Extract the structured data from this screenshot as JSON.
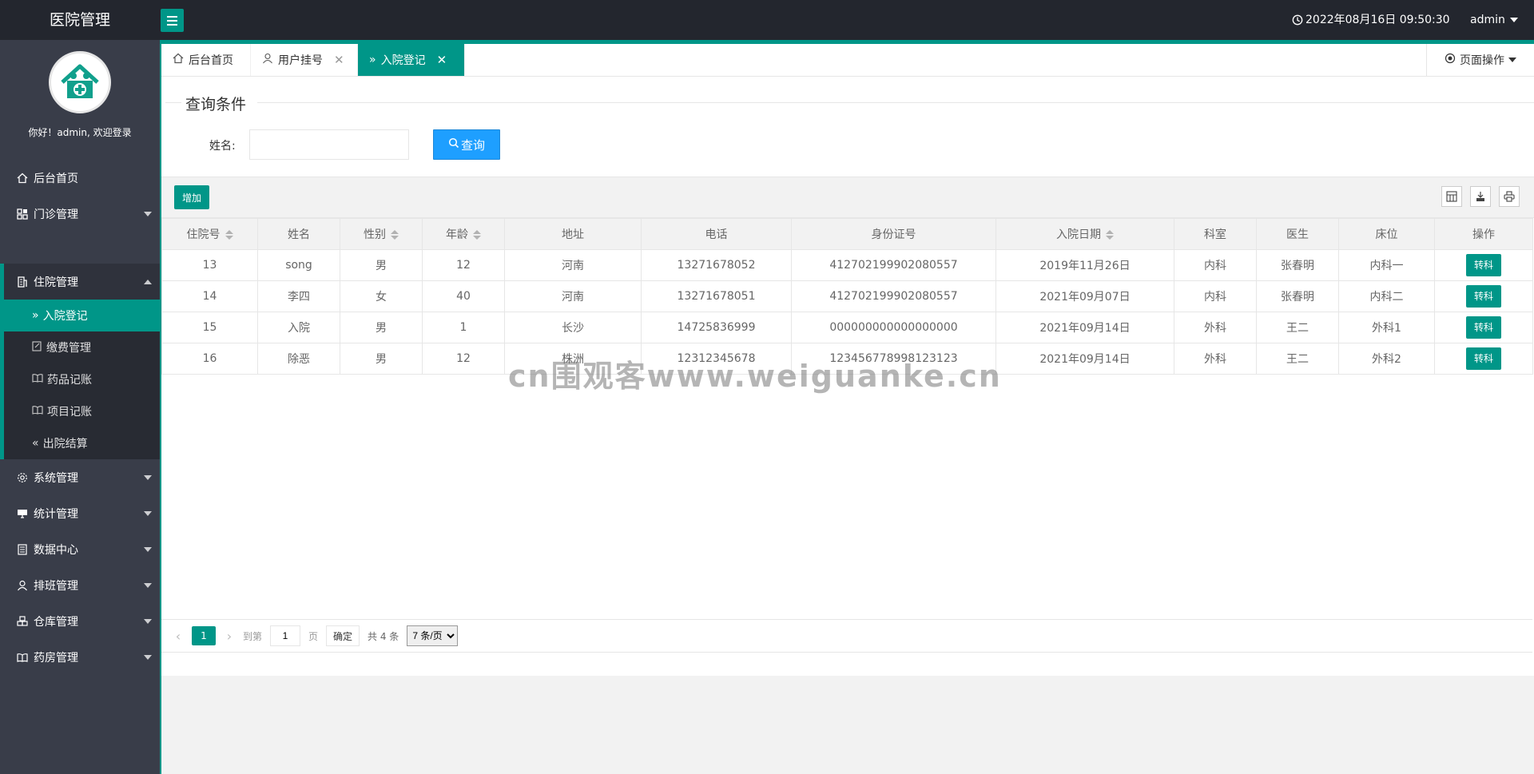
{
  "header": {
    "brand": "医院管理",
    "datetime": "2022年08月16日 09:50:30",
    "user": "admin"
  },
  "sidebar": {
    "greeting": "你好！admin, 欢迎登录",
    "items": [
      {
        "label": "后台首页",
        "icon": "home-icon"
      },
      {
        "label": "门诊管理",
        "icon": "apps-icon"
      },
      {
        "label": "住院管理",
        "icon": "building-icon",
        "expanded": true
      },
      {
        "label": "系统管理",
        "icon": "gear-icon"
      },
      {
        "label": "统计管理",
        "icon": "monitor-icon"
      },
      {
        "label": "数据中心",
        "icon": "document-icon"
      },
      {
        "label": "排班管理",
        "icon": "user-icon"
      },
      {
        "label": "仓库管理",
        "icon": "boxes-icon"
      },
      {
        "label": "药房管理",
        "icon": "book-icon"
      }
    ],
    "subitems": [
      {
        "label": "入院登记",
        "icon": "double-chevron-right-icon",
        "active": true
      },
      {
        "label": "缴费管理",
        "icon": "edit-icon"
      },
      {
        "label": "药品记账",
        "icon": "book-icon"
      },
      {
        "label": "项目记账",
        "icon": "book-icon"
      },
      {
        "label": "出院结算",
        "icon": "double-chevron-left-icon"
      }
    ]
  },
  "tabs": [
    {
      "label": "后台首页",
      "icon": "home-icon"
    },
    {
      "label": "用户挂号",
      "icon": "user-icon",
      "close": "✕"
    },
    {
      "label": "入院登记",
      "icon": "double-chevron-right-icon",
      "close": "✕",
      "active": true
    }
  ],
  "page_ops": "页面操作",
  "search": {
    "title": "查询条件",
    "name_label": "姓名:",
    "name_value": "",
    "query_label": "查询"
  },
  "toolbar": {
    "add_label": "增加"
  },
  "table": {
    "columns": [
      "住院号",
      "姓名",
      "性别",
      "年龄",
      "地址",
      "电话",
      "身份证号",
      "入院日期",
      "科室",
      "医生",
      "床位",
      "操作"
    ],
    "rows": [
      [
        "13",
        "song",
        "男",
        "12",
        "河南",
        "13271678052",
        "412702199902080557",
        "2019年11月26日",
        "内科",
        "张春明",
        "内科一",
        "转科"
      ],
      [
        "14",
        "李四",
        "女",
        "40",
        "河南",
        "13271678051",
        "412702199902080557",
        "2021年09月07日",
        "内科",
        "张春明",
        "内科二",
        "转科"
      ],
      [
        "15",
        "入院",
        "男",
        "1",
        "长沙",
        "14725836999",
        "000000000000000000",
        "2021年09月14日",
        "外科",
        "王二",
        "外科1",
        "转科"
      ],
      [
        "16",
        "除恶",
        "男",
        "12",
        "株洲",
        "12312345678",
        "123456778998123123",
        "2021年09月14日",
        "外科",
        "王二",
        "外科2",
        "转科"
      ]
    ]
  },
  "pager": {
    "current": "1",
    "goto_prefix": "到第",
    "goto_value": "1",
    "goto_suffix": "页",
    "confirm": "确定",
    "total": "共 4 条",
    "page_size": "7 条/页"
  },
  "watermark": "cn围观客www.weiguanke.cn",
  "colors": {
    "accent": "#009688",
    "query_button": "#1e9fff",
    "header_bg": "#23262e",
    "sidebar_bg": "#393d49"
  }
}
